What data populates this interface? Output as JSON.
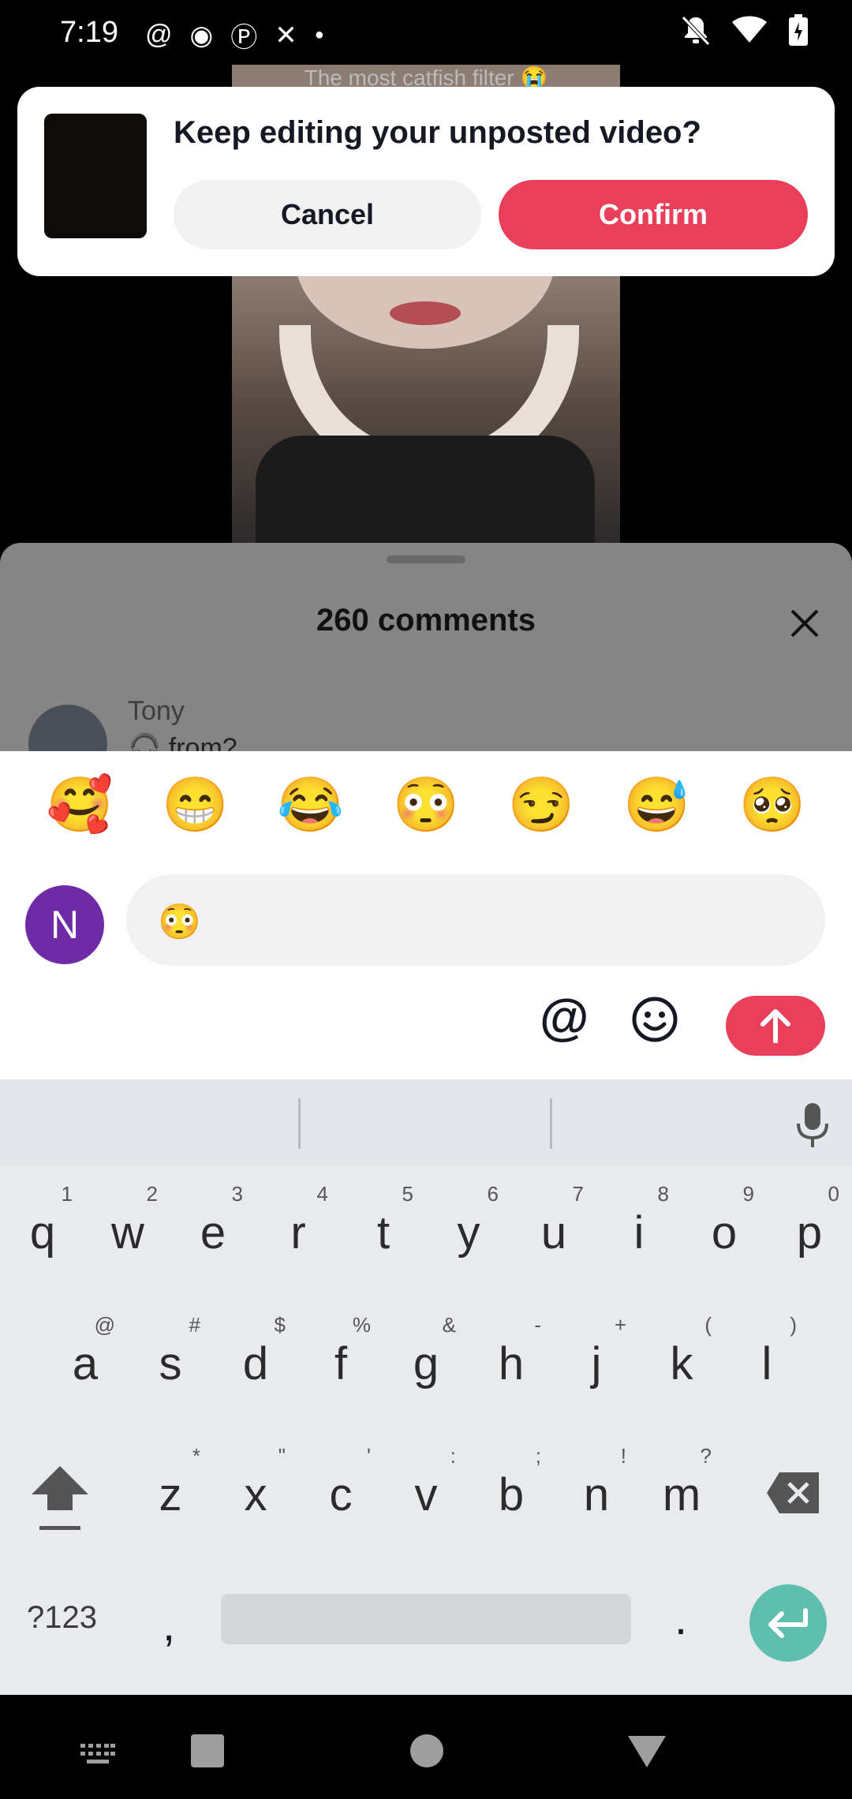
{
  "status_bar": {
    "time": "7:19",
    "left_icons": [
      "threads-icon",
      "circle-icon",
      "pinterest-icon",
      "capcut-icon",
      "dot-icon"
    ],
    "right_icons": [
      "bell-off-icon",
      "wifi-icon",
      "battery-charging-icon"
    ]
  },
  "video": {
    "caption": "The most catfish filter 😭"
  },
  "dialog": {
    "title": "Keep editing your unposted video?",
    "cancel_label": "Cancel",
    "confirm_label": "Confirm"
  },
  "comments": {
    "count_label": "260 comments",
    "first_comment": {
      "author": "Tony",
      "text": "🎧 from?"
    }
  },
  "emoji_bar": [
    "🥰",
    "😁",
    "😂",
    "😳",
    "😏",
    "😅",
    "🥺"
  ],
  "composer": {
    "avatar_letter": "N",
    "input_value": "😳",
    "at_label": "@",
    "colors": {
      "accent": "#ea3f5a",
      "avatar": "#6f2aa6"
    }
  },
  "keyboard": {
    "row1": [
      [
        "q",
        "1"
      ],
      [
        "w",
        "2"
      ],
      [
        "e",
        "3"
      ],
      [
        "r",
        "4"
      ],
      [
        "t",
        "5"
      ],
      [
        "y",
        "6"
      ],
      [
        "u",
        "7"
      ],
      [
        "i",
        "8"
      ],
      [
        "o",
        "9"
      ],
      [
        "p",
        "0"
      ]
    ],
    "row2": [
      [
        "a",
        "@"
      ],
      [
        "s",
        "#"
      ],
      [
        "d",
        "$"
      ],
      [
        "f",
        "%"
      ],
      [
        "g",
        "&"
      ],
      [
        "h",
        "-"
      ],
      [
        "j",
        "+"
      ],
      [
        "k",
        "("
      ],
      [
        "l",
        ")"
      ]
    ],
    "row3": [
      [
        "z",
        "*"
      ],
      [
        "x",
        "\""
      ],
      [
        "c",
        "'"
      ],
      [
        "v",
        ":"
      ],
      [
        "b",
        ";"
      ],
      [
        "n",
        "!"
      ],
      [
        "m",
        "?"
      ]
    ],
    "symbols_label": "?123",
    "comma": ",",
    "period": "."
  }
}
